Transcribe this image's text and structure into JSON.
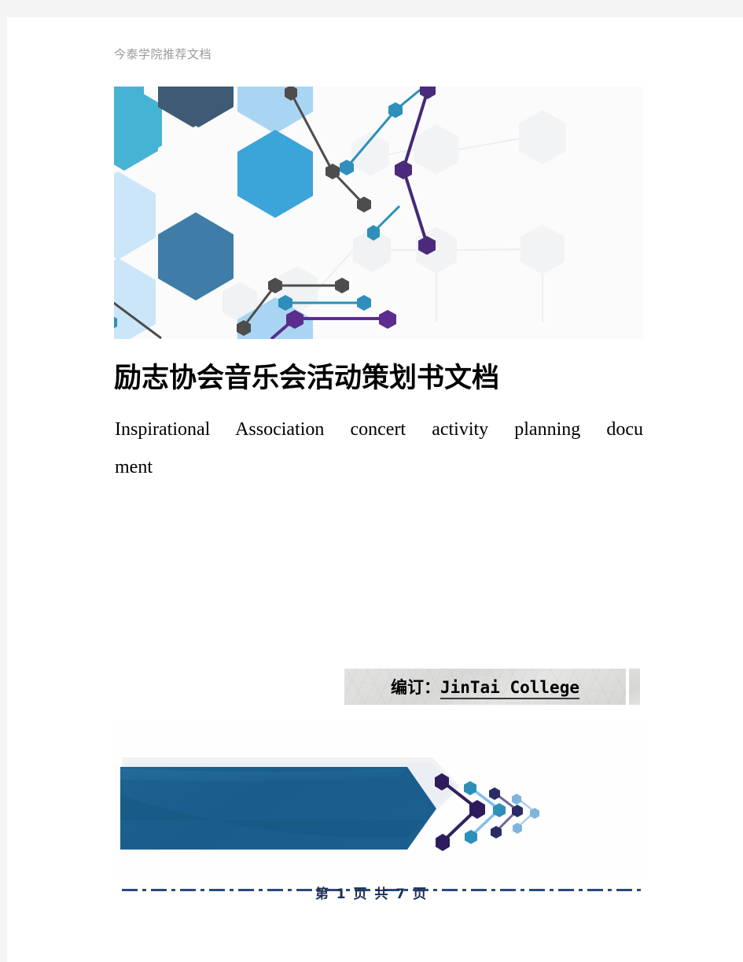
{
  "document": {
    "running_header": "今泰学院推荐文档",
    "title_cn": "励志协会音乐会活动策划书文档",
    "title_en_line1": "Inspirational Association concert activity planning docu",
    "title_en_line2": "ment",
    "editor_label": "编订：",
    "editor_name": "JinTai  College",
    "footer_page": "第 1 页 共 7 页"
  },
  "colors": {
    "page_background": "#ffffff",
    "canvas_background": "#f4f4f4",
    "header_text": "#9a9a9a",
    "footer_rule": "#2b4a7d",
    "footer_text": "#1d2f52",
    "hex_teal": "#45b4d4",
    "hex_dark_slate": "#3f5a74",
    "hex_light_blue": "#a9d5f2",
    "hex_mid_blue": "#3ba4d8",
    "hex_steel_blue": "#3f7da8",
    "hex_pale_blue": "#cbe6f8",
    "node_purple": "#5b2d8e",
    "node_gray": "#4d4d4d",
    "node_teal": "#2e8fba",
    "arrow_blue": "#1b5f8f",
    "banner_stone": "#dededd"
  },
  "artwork": {
    "header_image_name": "hexagon-network-banner",
    "footer_image_name": "blue-arrow-chevron-banner",
    "editor_banner_name": "stone-texture-plate"
  }
}
